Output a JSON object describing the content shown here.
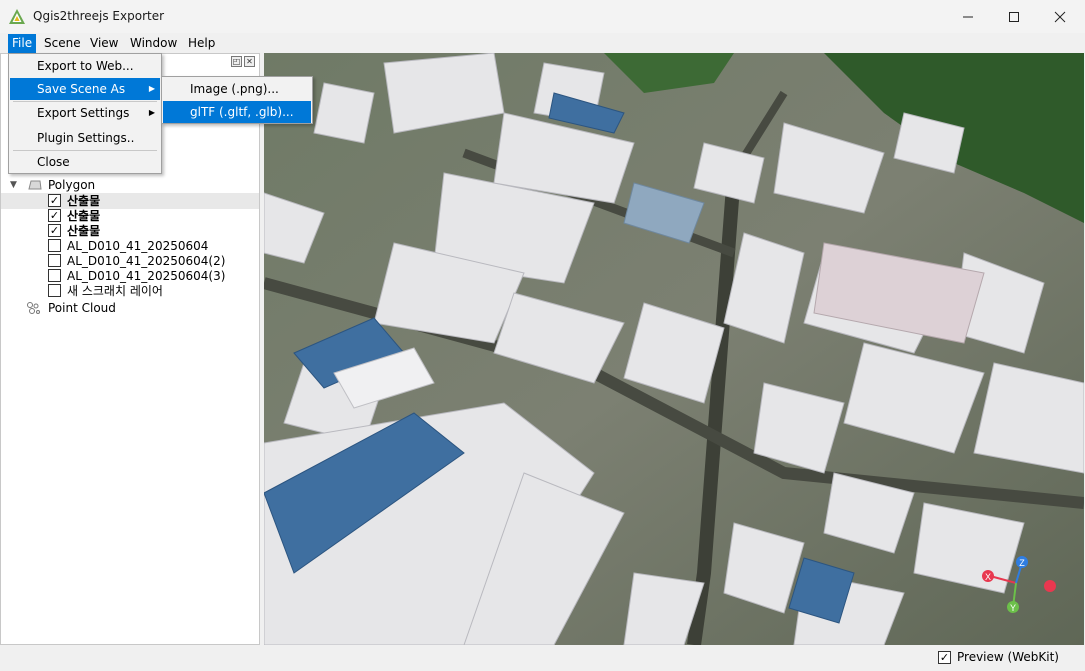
{
  "window": {
    "title": "Qgis2threejs Exporter",
    "minimize_icon": "minimize-icon",
    "maximize_icon": "maximize-icon",
    "close_icon": "close-icon"
  },
  "menubar": {
    "file": "File",
    "scene": "Scene",
    "view": "View",
    "window": "Window",
    "help": "Help"
  },
  "file_menu": {
    "items": [
      "Export to Web...",
      "Save Scene As",
      "Export Settings",
      "Plugin Settings..",
      "Close"
    ]
  },
  "save_scene_submenu": {
    "items": [
      "Image (.png)...",
      "glTF (.gltf, .glb)..."
    ]
  },
  "layer_tree": {
    "polygon_group": "Polygon",
    "layers": [
      {
        "label": "산출물",
        "checked": true,
        "bold": true
      },
      {
        "label": "산출물",
        "checked": true,
        "bold": true
      },
      {
        "label": "산출물",
        "checked": true,
        "bold": true
      },
      {
        "label": "AL_D010_41_20250604",
        "checked": false,
        "bold": false
      },
      {
        "label": "AL_D010_41_20250604(2)",
        "checked": false,
        "bold": false
      },
      {
        "label": "AL_D010_41_20250604(3)",
        "checked": false,
        "bold": false
      },
      {
        "label": "새 스크래치 레이어",
        "checked": false,
        "bold": false
      }
    ],
    "point_cloud_group": "Point Cloud"
  },
  "status": {
    "preview_label": "Preview (WebKit)",
    "preview_checked": true,
    "check_mark": "✓"
  },
  "axis_gizmo": {
    "x_label": "X",
    "y_label": "Y",
    "z_label": "Z",
    "colors": {
      "x": "#e8384f",
      "y": "#6cc04a",
      "z": "#2f7de1"
    }
  }
}
